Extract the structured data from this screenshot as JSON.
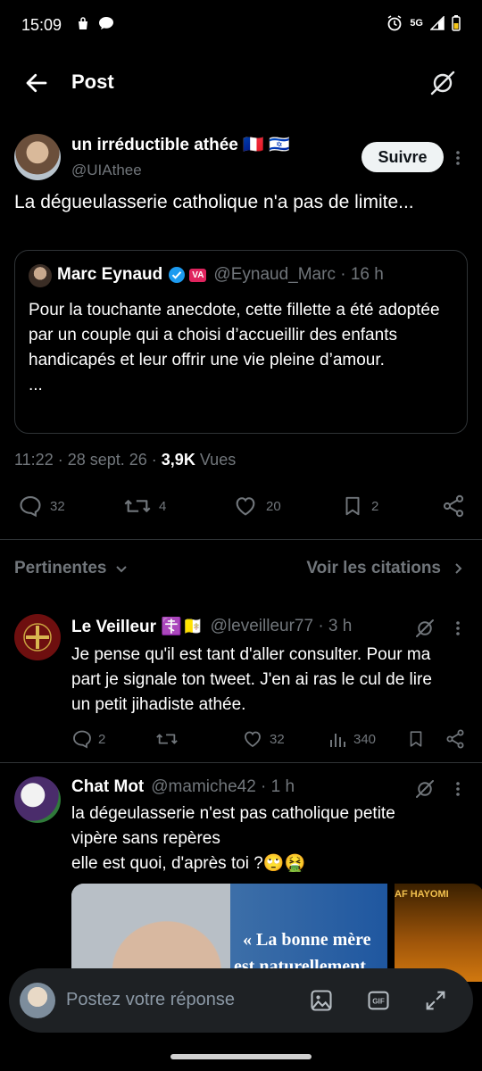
{
  "status_bar": {
    "time": "15:09",
    "network": "5G"
  },
  "header": {
    "title": "Post"
  },
  "main_post": {
    "author_name": "un irréductible athée 🇫🇷 🇮🇱",
    "handle": "@UIAthee",
    "follow_label": "Suivre",
    "text": "La dégueulasserie catholique n'a pas de limite...",
    "quote": {
      "author_name": "Marc Eynaud",
      "badge": "VA",
      "handle_time": "@Eynaud_Marc · 16 h",
      "text": "Pour la touchante anecdote, cette fillette a été adoptée par un couple qui a choisi d’accueillir des enfants handicapés et leur offrir une vie pleine d’amour.",
      "ellipsis": "..."
    },
    "time": "11:22",
    "date": "28 sept. 26",
    "views_count": "3,9K",
    "views_label": "Vues",
    "stats": {
      "replies": "32",
      "reposts": "4",
      "likes": "20",
      "bookmarks": "2"
    }
  },
  "sort_bar": {
    "left_label": "Pertinentes",
    "right_label": "Voir les citations"
  },
  "replies": [
    {
      "author_name": "Le Veilleur ☦️🇻🇦",
      "handle_time": "@leveilleur77 · 3 h",
      "text": "Je pense qu'il est tant d'aller consulter. Pour ma part je signale ton tweet. J'en ai ras le cul de lire un petit jihadiste athée.",
      "stats": {
        "replies": "2",
        "reposts": "",
        "likes": "32",
        "views": "340"
      }
    },
    {
      "author_name": "Chat Mot",
      "handle_time": "@mamiche42 · 1 h",
      "text_line1": "la dégeulasserie n'est pas catholique petite vipère sans repères",
      "text_line2": "elle est quoi, d'après toi ?🙄🤮",
      "image_text_1": "« La bonne mère",
      "image_text_2": "est naturellement",
      "image2_text": "AF HAYOMI"
    }
  ],
  "composer": {
    "placeholder": "Postez votre réponse"
  },
  "colors": {
    "bg": "#000000",
    "muted": "#71767b",
    "verified": "#1d9bf0",
    "badge_red": "#e0245e"
  }
}
